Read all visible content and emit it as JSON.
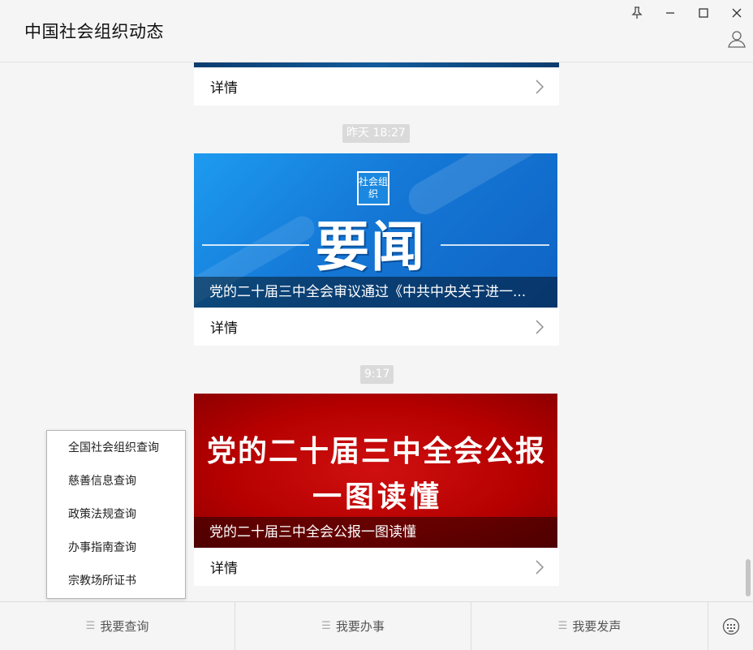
{
  "app": {
    "title": "中国社会组织动态"
  },
  "feed": {
    "detail_label": "详情",
    "items": [
      {
        "time": "",
        "caption": ""
      },
      {
        "time": "昨天 18:27",
        "caption": "党的二十届三中全会审议通过《中共中央关于进一...",
        "cover_logo": "社会组织",
        "cover_title": "要闻"
      },
      {
        "time": "9:17",
        "caption": "党的二十届三中全会公报一图读懂",
        "cover_line1": "党的二十届三中全会公报",
        "cover_line2": "一图读懂"
      }
    ]
  },
  "popup_menu": {
    "items": [
      "全国社会组织查询",
      "慈善信息查询",
      "政策法规查询",
      "办事指南查询",
      "宗教场所证书"
    ]
  },
  "bottom_menu": {
    "items": [
      "我要查询",
      "我要办事",
      "我要发声"
    ]
  },
  "icons": {
    "pin": "pin-icon",
    "minimize": "minimize-icon",
    "maximize": "maximize-icon",
    "close": "close-icon",
    "user": "user-icon",
    "keyboard": "keyboard-icon",
    "chevron": "chevron-right-icon",
    "menu": "menu-lines-icon"
  },
  "colors": {
    "blue_cover": "#1578d6",
    "red_cover": "#b50000"
  }
}
